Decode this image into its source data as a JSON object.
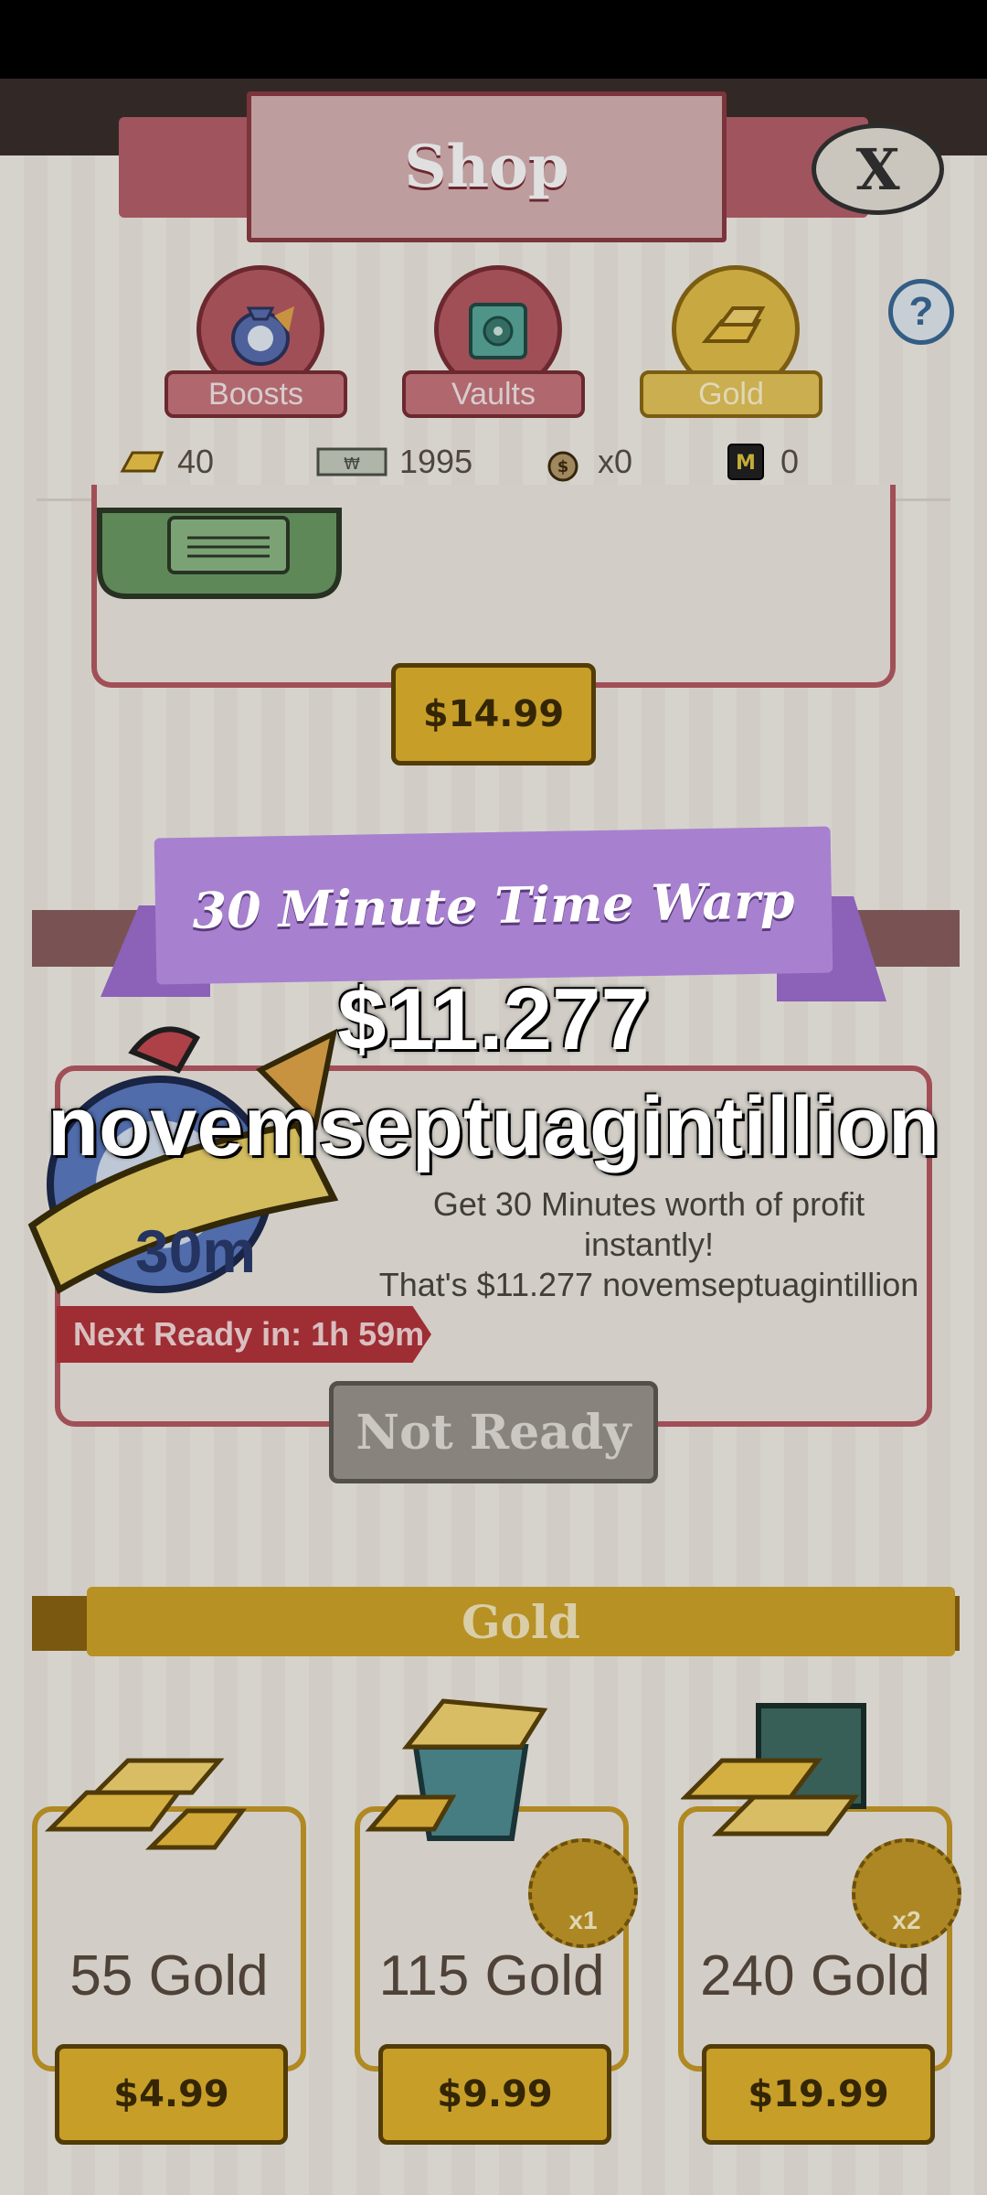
{
  "header": {
    "title": "Shop",
    "close_icon": "X",
    "help_icon": "?"
  },
  "tabs": [
    {
      "label": "Boosts",
      "icon": "boost-bag-icon"
    },
    {
      "label": "Vaults",
      "icon": "vault-icon"
    },
    {
      "label": "Gold",
      "icon": "gold-bars-icon",
      "selected": true
    }
  ],
  "currencies": [
    {
      "icon": "gold-bar-icon",
      "value": "40"
    },
    {
      "icon": "megabucks-icon",
      "value": "1995"
    },
    {
      "icon": "money-bag-icon",
      "value": "x0"
    },
    {
      "icon": "megaticket-icon",
      "value": "0"
    }
  ],
  "package": {
    "price": "$14.99"
  },
  "popup": {
    "ribbon_title": "30 Minute Time Warp",
    "amount_line1": "$11.277",
    "amount_line2": "novemseptuagintillion"
  },
  "boost": {
    "badge_text": "30m",
    "desc_line1": "Get 30 Minutes worth of profit",
    "desc_line2": "instantly!",
    "desc_line3": "That's $11.277 novemseptuagintillion",
    "next_ready": "Next Ready in: 1h 59m",
    "button_label": "Not Ready"
  },
  "gold_section": {
    "title": "Gold",
    "items": [
      {
        "label": "55 Gold",
        "price": "$4.99"
      },
      {
        "label": "115 Gold",
        "price": "$9.99",
        "badge": "x1"
      },
      {
        "label": "240 Gold",
        "price": "$19.99",
        "badge": "x2"
      }
    ]
  },
  "colors": {
    "shop_red": "#b85b64",
    "gold": "#e3b42d",
    "ribbon_purple": "#a781cf"
  }
}
